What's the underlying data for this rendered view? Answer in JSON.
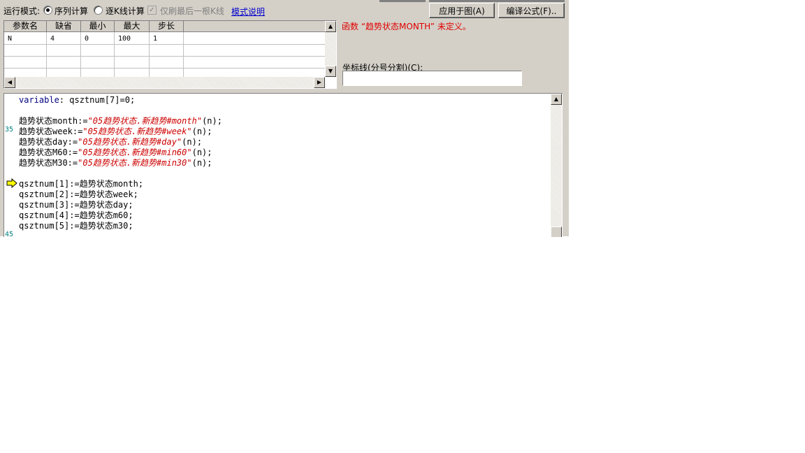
{
  "toolbar": {
    "mode_label": "运行模式:",
    "radio_sequence": "序列计算",
    "radio_by_kline": "逐K线计算",
    "checkbox_last_kline": "仅刷最后一根K线",
    "mode_help_link": "模式说明",
    "apply_button": "应用于图(A)",
    "compile_button": "编译公式(F).."
  },
  "params_table": {
    "columns": [
      "参数名",
      "缺省",
      "最小",
      "最大",
      "步长"
    ],
    "rows": [
      [
        "N",
        "4",
        "0",
        "100",
        "1"
      ]
    ]
  },
  "error_message": "函数 “趋势状态MONTH” 未定义。",
  "coordinate_line": {
    "label": "坐标线(分号分割)(C):",
    "value": ""
  },
  "editor": {
    "line_numbers": {
      "first": "35",
      "second": "45"
    },
    "lines": [
      [
        {
          "t": "variable",
          "c": "kw"
        },
        {
          "t": ": qsztnum[7]=0;",
          "c": ""
        }
      ],
      [],
      [
        {
          "t": "趋势状态month:=",
          "c": ""
        },
        {
          "t": "\"05趋势状态.新趋势#month\"",
          "c": "str"
        },
        {
          "t": "(n);",
          "c": ""
        }
      ],
      [
        {
          "t": "趋势状态week:=",
          "c": ""
        },
        {
          "t": "\"05趋势状态.新趋势#week\"",
          "c": "str"
        },
        {
          "t": "(n);",
          "c": ""
        }
      ],
      [
        {
          "t": "趋势状态day:=",
          "c": ""
        },
        {
          "t": "\"05趋势状态.新趋势#day\"",
          "c": "str"
        },
        {
          "t": "(n);",
          "c": ""
        }
      ],
      [
        {
          "t": "趋势状态M60:=",
          "c": ""
        },
        {
          "t": "\"05趋势状态.新趋势#min60\"",
          "c": "str"
        },
        {
          "t": "(n);",
          "c": ""
        }
      ],
      [
        {
          "t": "趋势状态M30:=",
          "c": ""
        },
        {
          "t": "\"05趋势状态.新趋势#min30\"",
          "c": "str"
        },
        {
          "t": "(n);",
          "c": ""
        }
      ],
      [],
      [
        {
          "t": "qsztnum[1]:=趋势状态month;",
          "c": ""
        }
      ],
      [
        {
          "t": "qsztnum[2]:=趋势状态week;",
          "c": ""
        }
      ],
      [
        {
          "t": "qsztnum[3]:=趋势状态day;",
          "c": ""
        }
      ],
      [
        {
          "t": "qsztnum[4]:=趋势状态m60;",
          "c": ""
        }
      ],
      [
        {
          "t": "qsztnum[5]:=趋势状态m30;",
          "c": ""
        }
      ]
    ]
  }
}
